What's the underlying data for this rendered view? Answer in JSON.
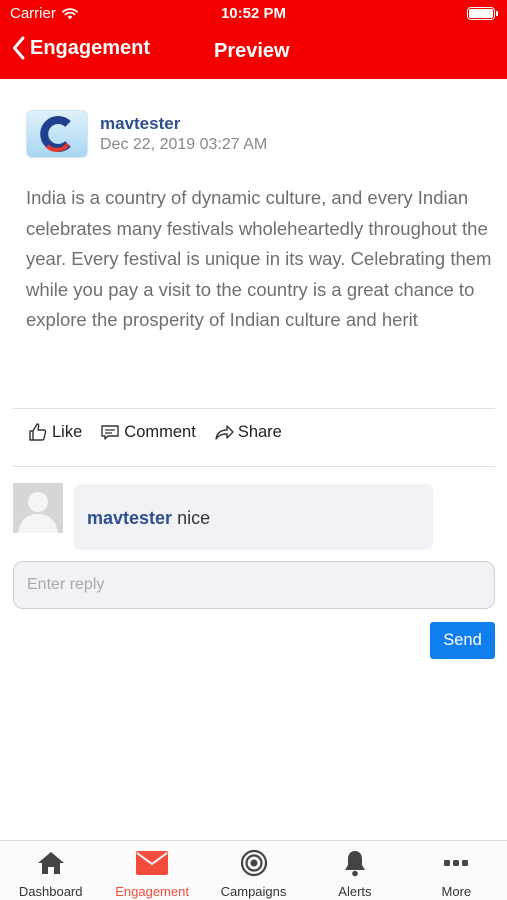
{
  "status_bar": {
    "carrier": "Carrier",
    "time": "10:52 PM"
  },
  "nav": {
    "back_label": "Engagement",
    "title": "Preview"
  },
  "post": {
    "author": "mavtester",
    "date": "Dec 22, 2019 03:27 AM",
    "body": "India is a country of dynamic culture, and every Indian celebrates many festivals wholeheartedly throughout the year. Every festival is unique in its way. Celebrating them while you pay a visit to the country is a great chance to explore the prosperity of Indian culture and herit",
    "logo_letter": "C"
  },
  "actions": {
    "like": "Like",
    "comment": "Comment",
    "share": "Share"
  },
  "comment": {
    "user": "mavtester",
    "text": "nice"
  },
  "reply": {
    "placeholder": "Enter reply",
    "send_label": "Send"
  },
  "tabs": [
    {
      "label": "Dashboard",
      "icon": "home-icon"
    },
    {
      "label": "Engagement",
      "icon": "envelope-icon",
      "active": true
    },
    {
      "label": "Campaigns",
      "icon": "target-icon"
    },
    {
      "label": "Alerts",
      "icon": "bell-icon"
    },
    {
      "label": "More",
      "icon": "more-icon"
    }
  ],
  "colors": {
    "header": "#f40000",
    "link": "#2f4f8f",
    "send": "#0f7ff0",
    "active_tab": "#f24c3d"
  }
}
